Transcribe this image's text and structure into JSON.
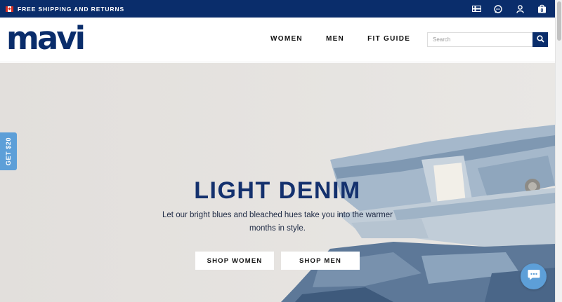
{
  "topbar": {
    "promo_text": "FREE SHIPPING AND RETURNS",
    "flag_icon": "canada-flag-icon",
    "tools": [
      {
        "name": "region-flag-icon"
      },
      {
        "name": "chat-bubble-icon"
      },
      {
        "name": "user-icon"
      },
      {
        "name": "cart-bag-icon",
        "count": "0"
      }
    ]
  },
  "header": {
    "logo": "mavi",
    "nav": [
      {
        "label": "WOMEN"
      },
      {
        "label": "MEN"
      },
      {
        "label": "FIT GUIDE"
      }
    ],
    "search": {
      "placeholder": "Search",
      "value": ""
    }
  },
  "hero": {
    "title": "LIGHT DENIM",
    "subtitle": "Let our bright blues and bleached hues take you into the warmer months in style.",
    "buttons": [
      {
        "label": "SHOP WOMEN"
      },
      {
        "label": "SHOP MEN"
      }
    ]
  },
  "side_tab": {
    "label": "GET $20"
  },
  "colors": {
    "brand_navy": "#0a2d6b",
    "hero_bg": "#e4e1de",
    "accent_blue": "#5d9fd8"
  }
}
